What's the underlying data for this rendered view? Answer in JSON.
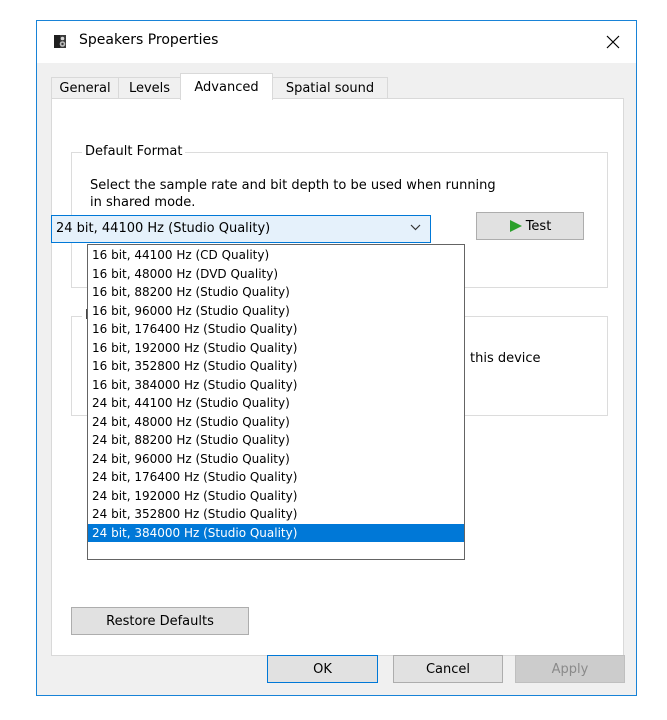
{
  "window": {
    "title": "Speakers Properties"
  },
  "tabs": [
    {
      "label": "General"
    },
    {
      "label": "Levels"
    },
    {
      "label": "Advanced"
    },
    {
      "label": "Spatial sound"
    }
  ],
  "default_format": {
    "legend": "Default Format",
    "description_line1": "Select the sample rate and bit depth to be used when running",
    "description_line2": "in shared mode.",
    "selected_value": "24 bit, 44100 Hz (Studio Quality)",
    "test_label": "Test"
  },
  "exclusive_mode": {
    "legend_fragment": "E",
    "text_fragment": "this device"
  },
  "dropdown": {
    "options": [
      "16 bit, 44100 Hz (CD Quality)",
      "16 bit, 48000 Hz (DVD Quality)",
      "16 bit, 88200 Hz (Studio Quality)",
      "16 bit, 96000 Hz (Studio Quality)",
      "16 bit, 176400 Hz (Studio Quality)",
      "16 bit, 192000 Hz (Studio Quality)",
      "16 bit, 352800 Hz (Studio Quality)",
      "16 bit, 384000 Hz (Studio Quality)",
      "24 bit, 44100 Hz (Studio Quality)",
      "24 bit, 48000 Hz (Studio Quality)",
      "24 bit, 88200 Hz (Studio Quality)",
      "24 bit, 96000 Hz (Studio Quality)",
      "24 bit, 176400 Hz (Studio Quality)",
      "24 bit, 192000 Hz (Studio Quality)",
      "24 bit, 352800 Hz (Studio Quality)",
      "24 bit, 384000 Hz (Studio Quality)"
    ],
    "highlighted_index": 15
  },
  "buttons": {
    "restore_defaults": "Restore Defaults",
    "ok": "OK",
    "cancel": "Cancel",
    "apply": "Apply"
  },
  "colors": {
    "accent": "#0078d7",
    "window_border": "#1883d7",
    "dialog_background": "#f0f0f0",
    "test_icon": "#2aa02a"
  },
  "icons": {
    "title": "speaker-icon",
    "close": "close-icon",
    "combo_arrow": "chevron-down-icon",
    "test": "play-icon"
  }
}
